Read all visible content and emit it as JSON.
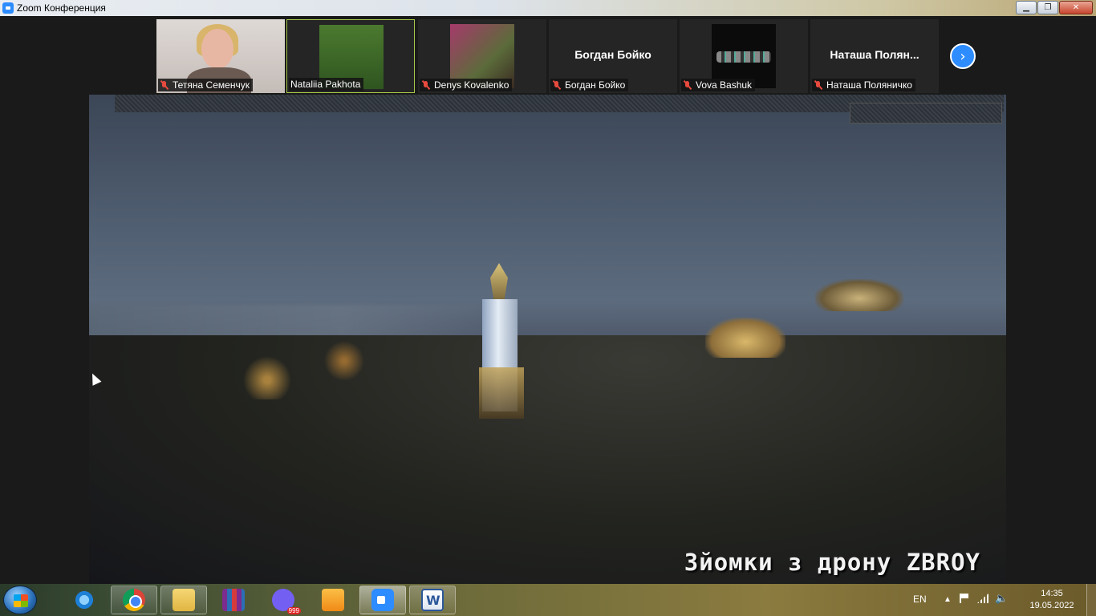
{
  "window": {
    "title": "Zoom Конференция",
    "controls": {
      "minimize": "▁",
      "restore": "❐",
      "close": "✕"
    }
  },
  "participants": [
    {
      "name": "Тетяна Семенчук",
      "muted": true,
      "video": "camera"
    },
    {
      "name": "Nataliia Pakhota",
      "muted": false,
      "video": "photo",
      "active_speaker": true
    },
    {
      "name": "Denys Kovalenko",
      "muted": true,
      "video": "photo"
    },
    {
      "name": "Богдан Бойко",
      "muted": true,
      "video": "none",
      "display_name": "Богдан Бойко"
    },
    {
      "name": "Vova Bashuk",
      "muted": true,
      "video": "photo"
    },
    {
      "name": "Наташа Поляничко",
      "muted": true,
      "video": "none",
      "display_name": "Наташа  Полян..."
    }
  ],
  "next_page_icon": "chevron-right-icon",
  "shared_video": {
    "caption": "Зйомки з дрону ZBROY"
  },
  "taskbar": {
    "apps": [
      {
        "name": "internet-explorer-icon"
      },
      {
        "name": "chrome-icon"
      },
      {
        "name": "file-explorer-icon"
      },
      {
        "name": "winrar-icon"
      },
      {
        "name": "viber-icon",
        "badge": "999"
      },
      {
        "name": "media-player-icon"
      },
      {
        "name": "zoom-icon",
        "active": true
      },
      {
        "name": "word-icon"
      }
    ],
    "tray": {
      "language": "EN",
      "time": "14:35",
      "date": "19.05.2022"
    }
  },
  "colors": {
    "zoom_blue": "#2d8cff",
    "active_speaker_border": "#a6c94a",
    "muted_red": "#e84a3e"
  }
}
